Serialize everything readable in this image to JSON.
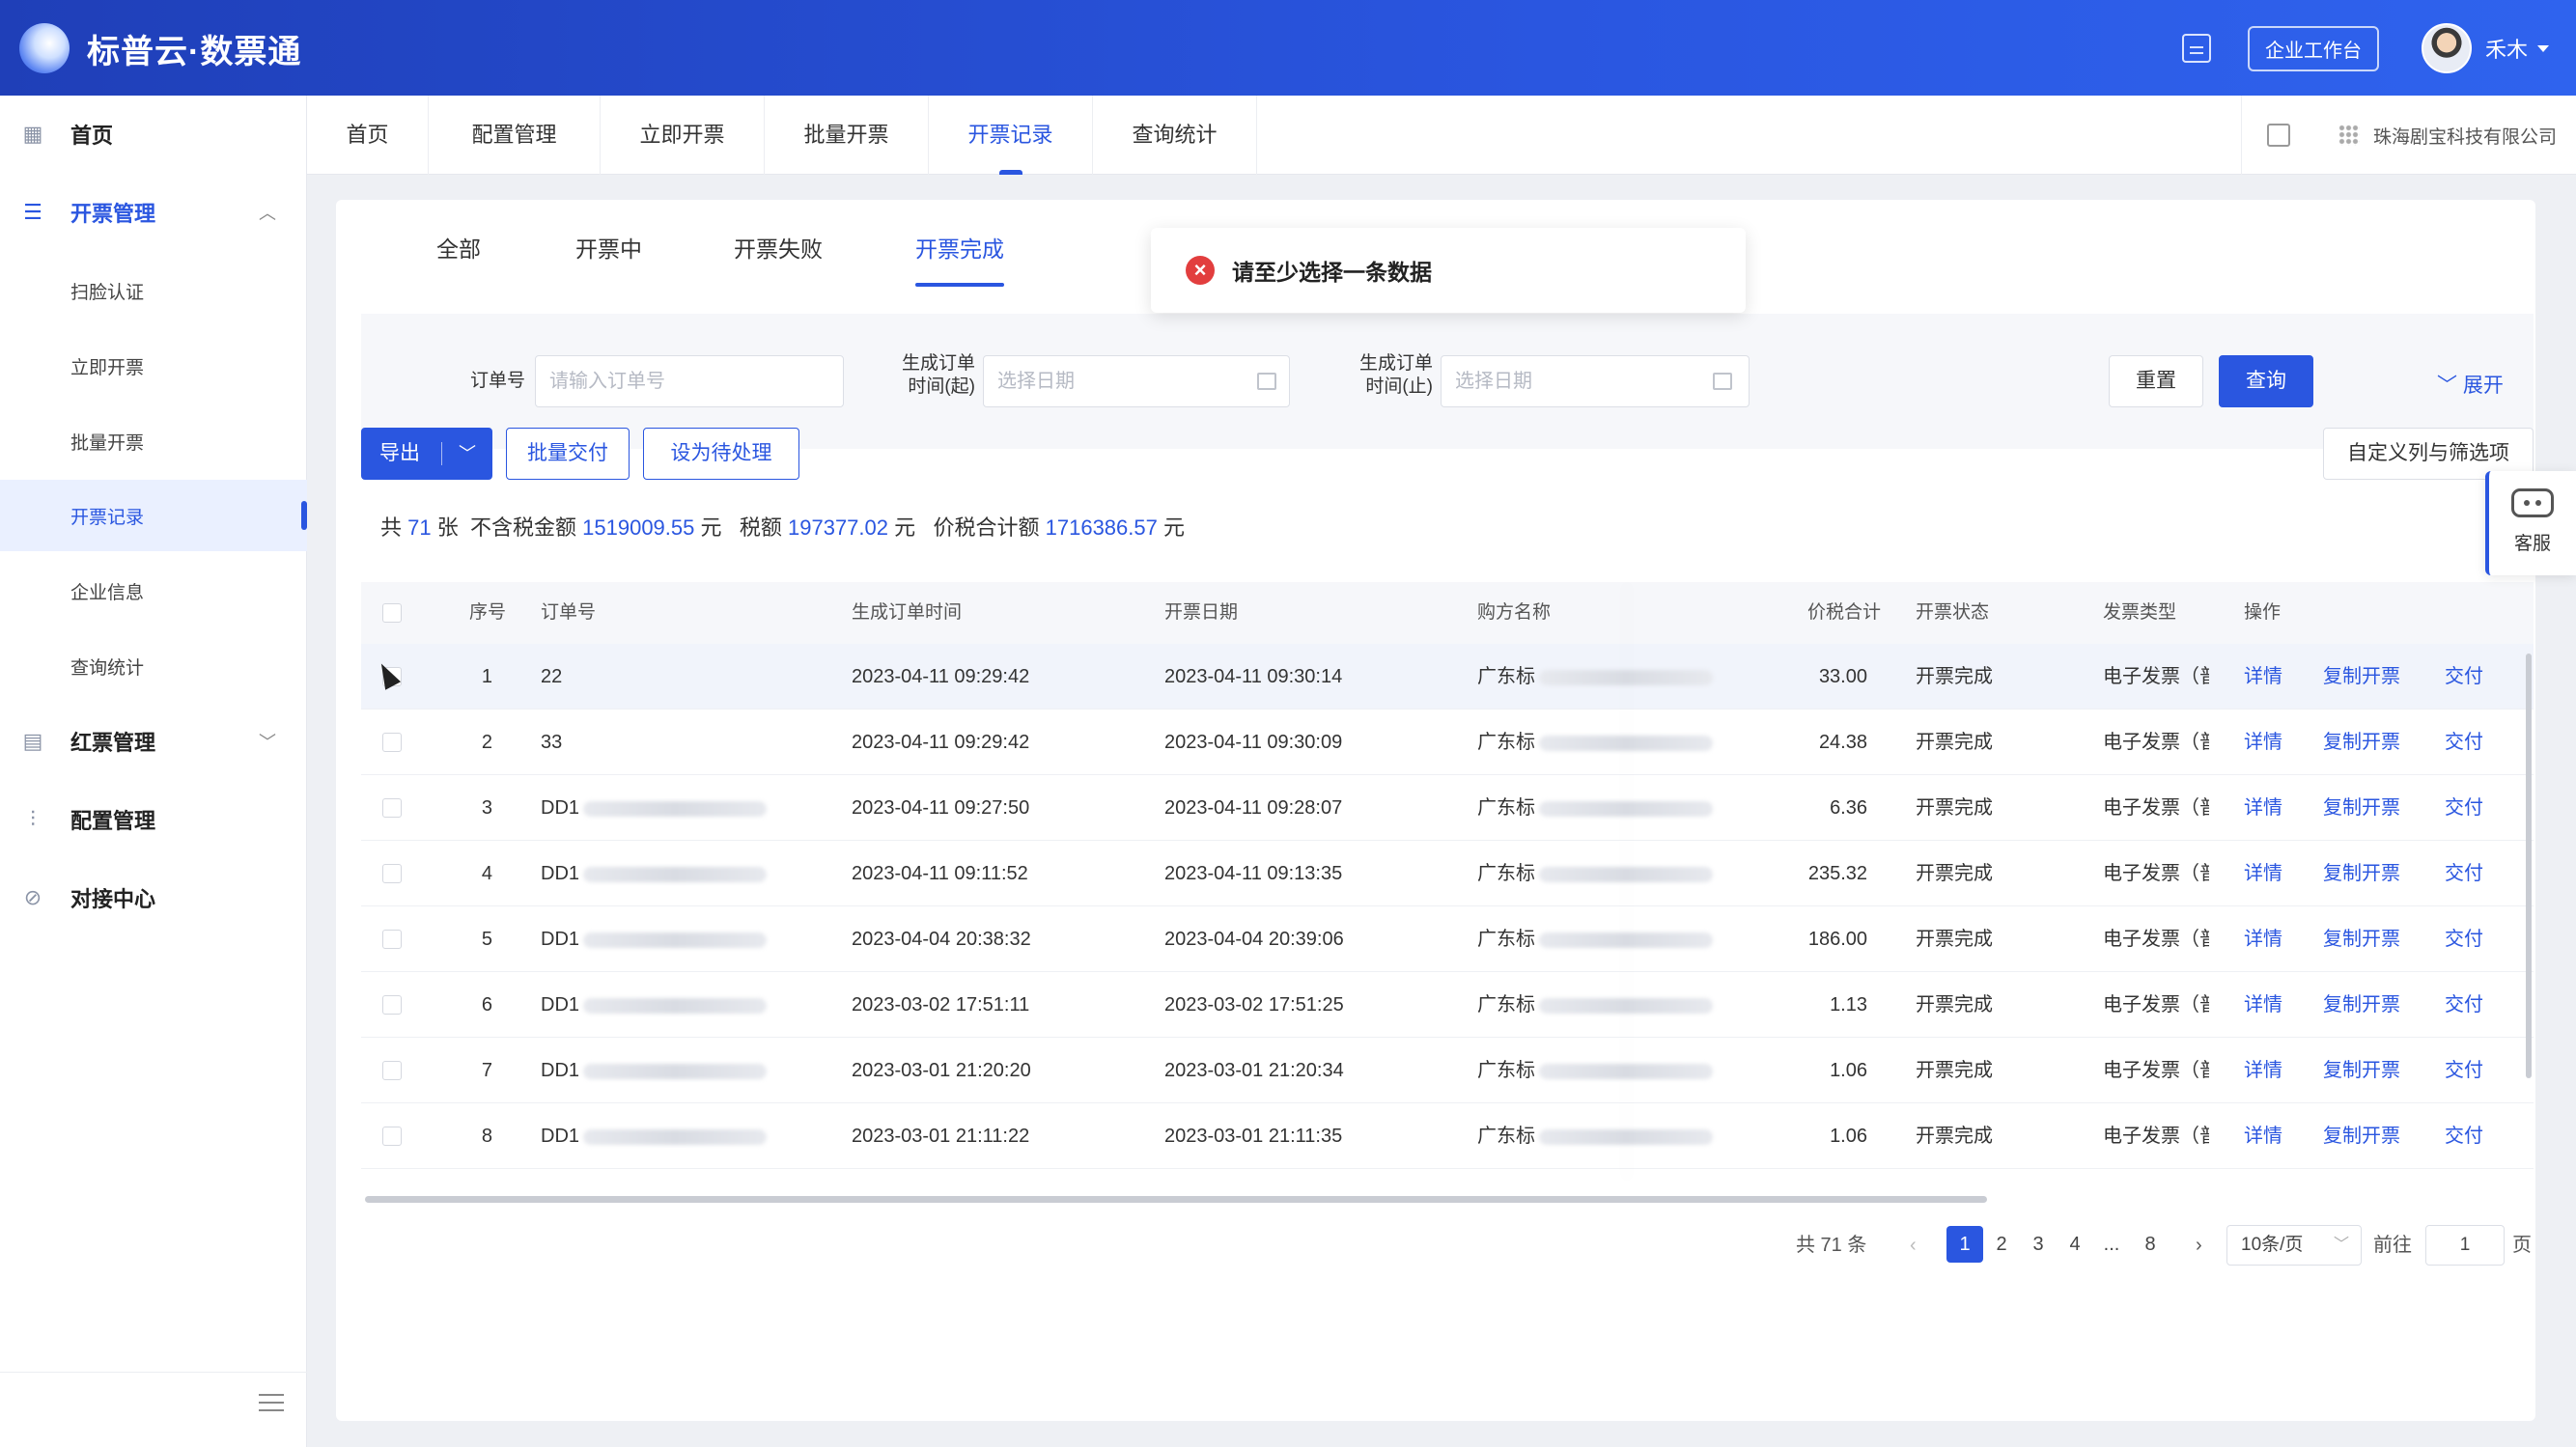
{
  "app": {
    "title": "标普云·数票通"
  },
  "header": {
    "workbench_label": "企业工作台",
    "username": "禾木"
  },
  "sidebar": {
    "home": "首页",
    "invoice_group": "开票管理",
    "invoice_items": [
      "扫脸认证",
      "立即开票",
      "批量开票",
      "开票记录",
      "企业信息",
      "查询统计"
    ],
    "red_group": "红票管理",
    "config": "配置管理",
    "integration": "对接中心"
  },
  "nav": {
    "tabs": [
      "首页",
      "配置管理",
      "立即开票",
      "批量开票",
      "开票记录",
      "查询统计"
    ],
    "active_tab": "开票记录",
    "company": "珠海剧宝科技有限公司"
  },
  "subtabs": {
    "items": [
      "全部",
      "开票中",
      "开票失败",
      "开票完成"
    ],
    "active": "开票完成"
  },
  "filter": {
    "order_label": "订单号",
    "order_placeholder": "请输入订单号",
    "start_label_1": "生成订单",
    "start_label_2": "时间(起)",
    "start_placeholder": "选择日期",
    "end_label_1": "生成订单",
    "end_label_2": "时间(止)",
    "end_placeholder": "选择日期",
    "reset": "重置",
    "query": "查询",
    "expand": "展开"
  },
  "toolbar": {
    "export": "导出",
    "batch_deliver": "批量交付",
    "set_pending": "设为待处理",
    "custom_columns": "自定义列与筛选项"
  },
  "summary": {
    "prefix": "共",
    "count": "71",
    "count_unit": "张",
    "untaxed_label": "不含税金额",
    "untaxed": "1519009.55",
    "tax_label": "税额",
    "tax": "197377.02",
    "total_label": "价税合计额",
    "total": "1716386.57",
    "unit": "元"
  },
  "table": {
    "headers": [
      "序号",
      "订单号",
      "生成订单时间",
      "开票日期",
      "购方名称",
      "价税合计",
      "开票状态",
      "发票类型",
      "操作"
    ],
    "rows": [
      {
        "no": "1",
        "order": "22",
        "created": "2023-04-11 09:29:42",
        "invoice_date": "2023-04-11 09:30:14",
        "buyer": "广东标",
        "amount": "33.00",
        "status": "开票完成",
        "type": "电子发票（普"
      },
      {
        "no": "2",
        "order": "33",
        "created": "2023-04-11 09:29:42",
        "invoice_date": "2023-04-11 09:30:09",
        "buyer": "广东标",
        "amount": "24.38",
        "status": "开票完成",
        "type": "电子发票（普"
      },
      {
        "no": "3",
        "order": "DD1",
        "created": "2023-04-11 09:27:50",
        "invoice_date": "2023-04-11 09:28:07",
        "buyer": "广东标",
        "amount": "6.36",
        "status": "开票完成",
        "type": "电子发票（普"
      },
      {
        "no": "4",
        "order": "DD1",
        "created": "2023-04-11 09:11:52",
        "invoice_date": "2023-04-11 09:13:35",
        "buyer": "广东标",
        "amount": "235.32",
        "status": "开票完成",
        "type": "电子发票（普"
      },
      {
        "no": "5",
        "order": "DD1",
        "created": "2023-04-04 20:38:32",
        "invoice_date": "2023-04-04 20:39:06",
        "buyer": "广东标",
        "amount": "186.00",
        "status": "开票完成",
        "type": "电子发票（普"
      },
      {
        "no": "6",
        "order": "DD1",
        "created": "2023-03-02 17:51:11",
        "invoice_date": "2023-03-02 17:51:25",
        "buyer": "广东标",
        "amount": "1.13",
        "status": "开票完成",
        "type": "电子发票（普"
      },
      {
        "no": "7",
        "order": "DD1",
        "created": "2023-03-01 21:20:20",
        "invoice_date": "2023-03-01 21:20:34",
        "buyer": "广东标",
        "amount": "1.06",
        "status": "开票完成",
        "type": "电子发票（普"
      },
      {
        "no": "8",
        "order": "DD1",
        "created": "2023-03-01 21:11:22",
        "invoice_date": "2023-03-01 21:11:35",
        "buyer": "广东标",
        "amount": "1.06",
        "status": "开票完成",
        "type": "电子发票（普"
      }
    ],
    "ops": {
      "detail": "详情",
      "copy": "复制开票",
      "deliver": "交付"
    }
  },
  "pagination": {
    "total": "共 71 条",
    "pages": [
      "1",
      "2",
      "3",
      "4",
      "...",
      "8"
    ],
    "current": "1",
    "page_size": "10条/页",
    "goto_label": "前往",
    "goto_value": "1",
    "page_unit": "页"
  },
  "toast": {
    "message": "请至少选择一条数据"
  },
  "support": {
    "label": "客服"
  }
}
